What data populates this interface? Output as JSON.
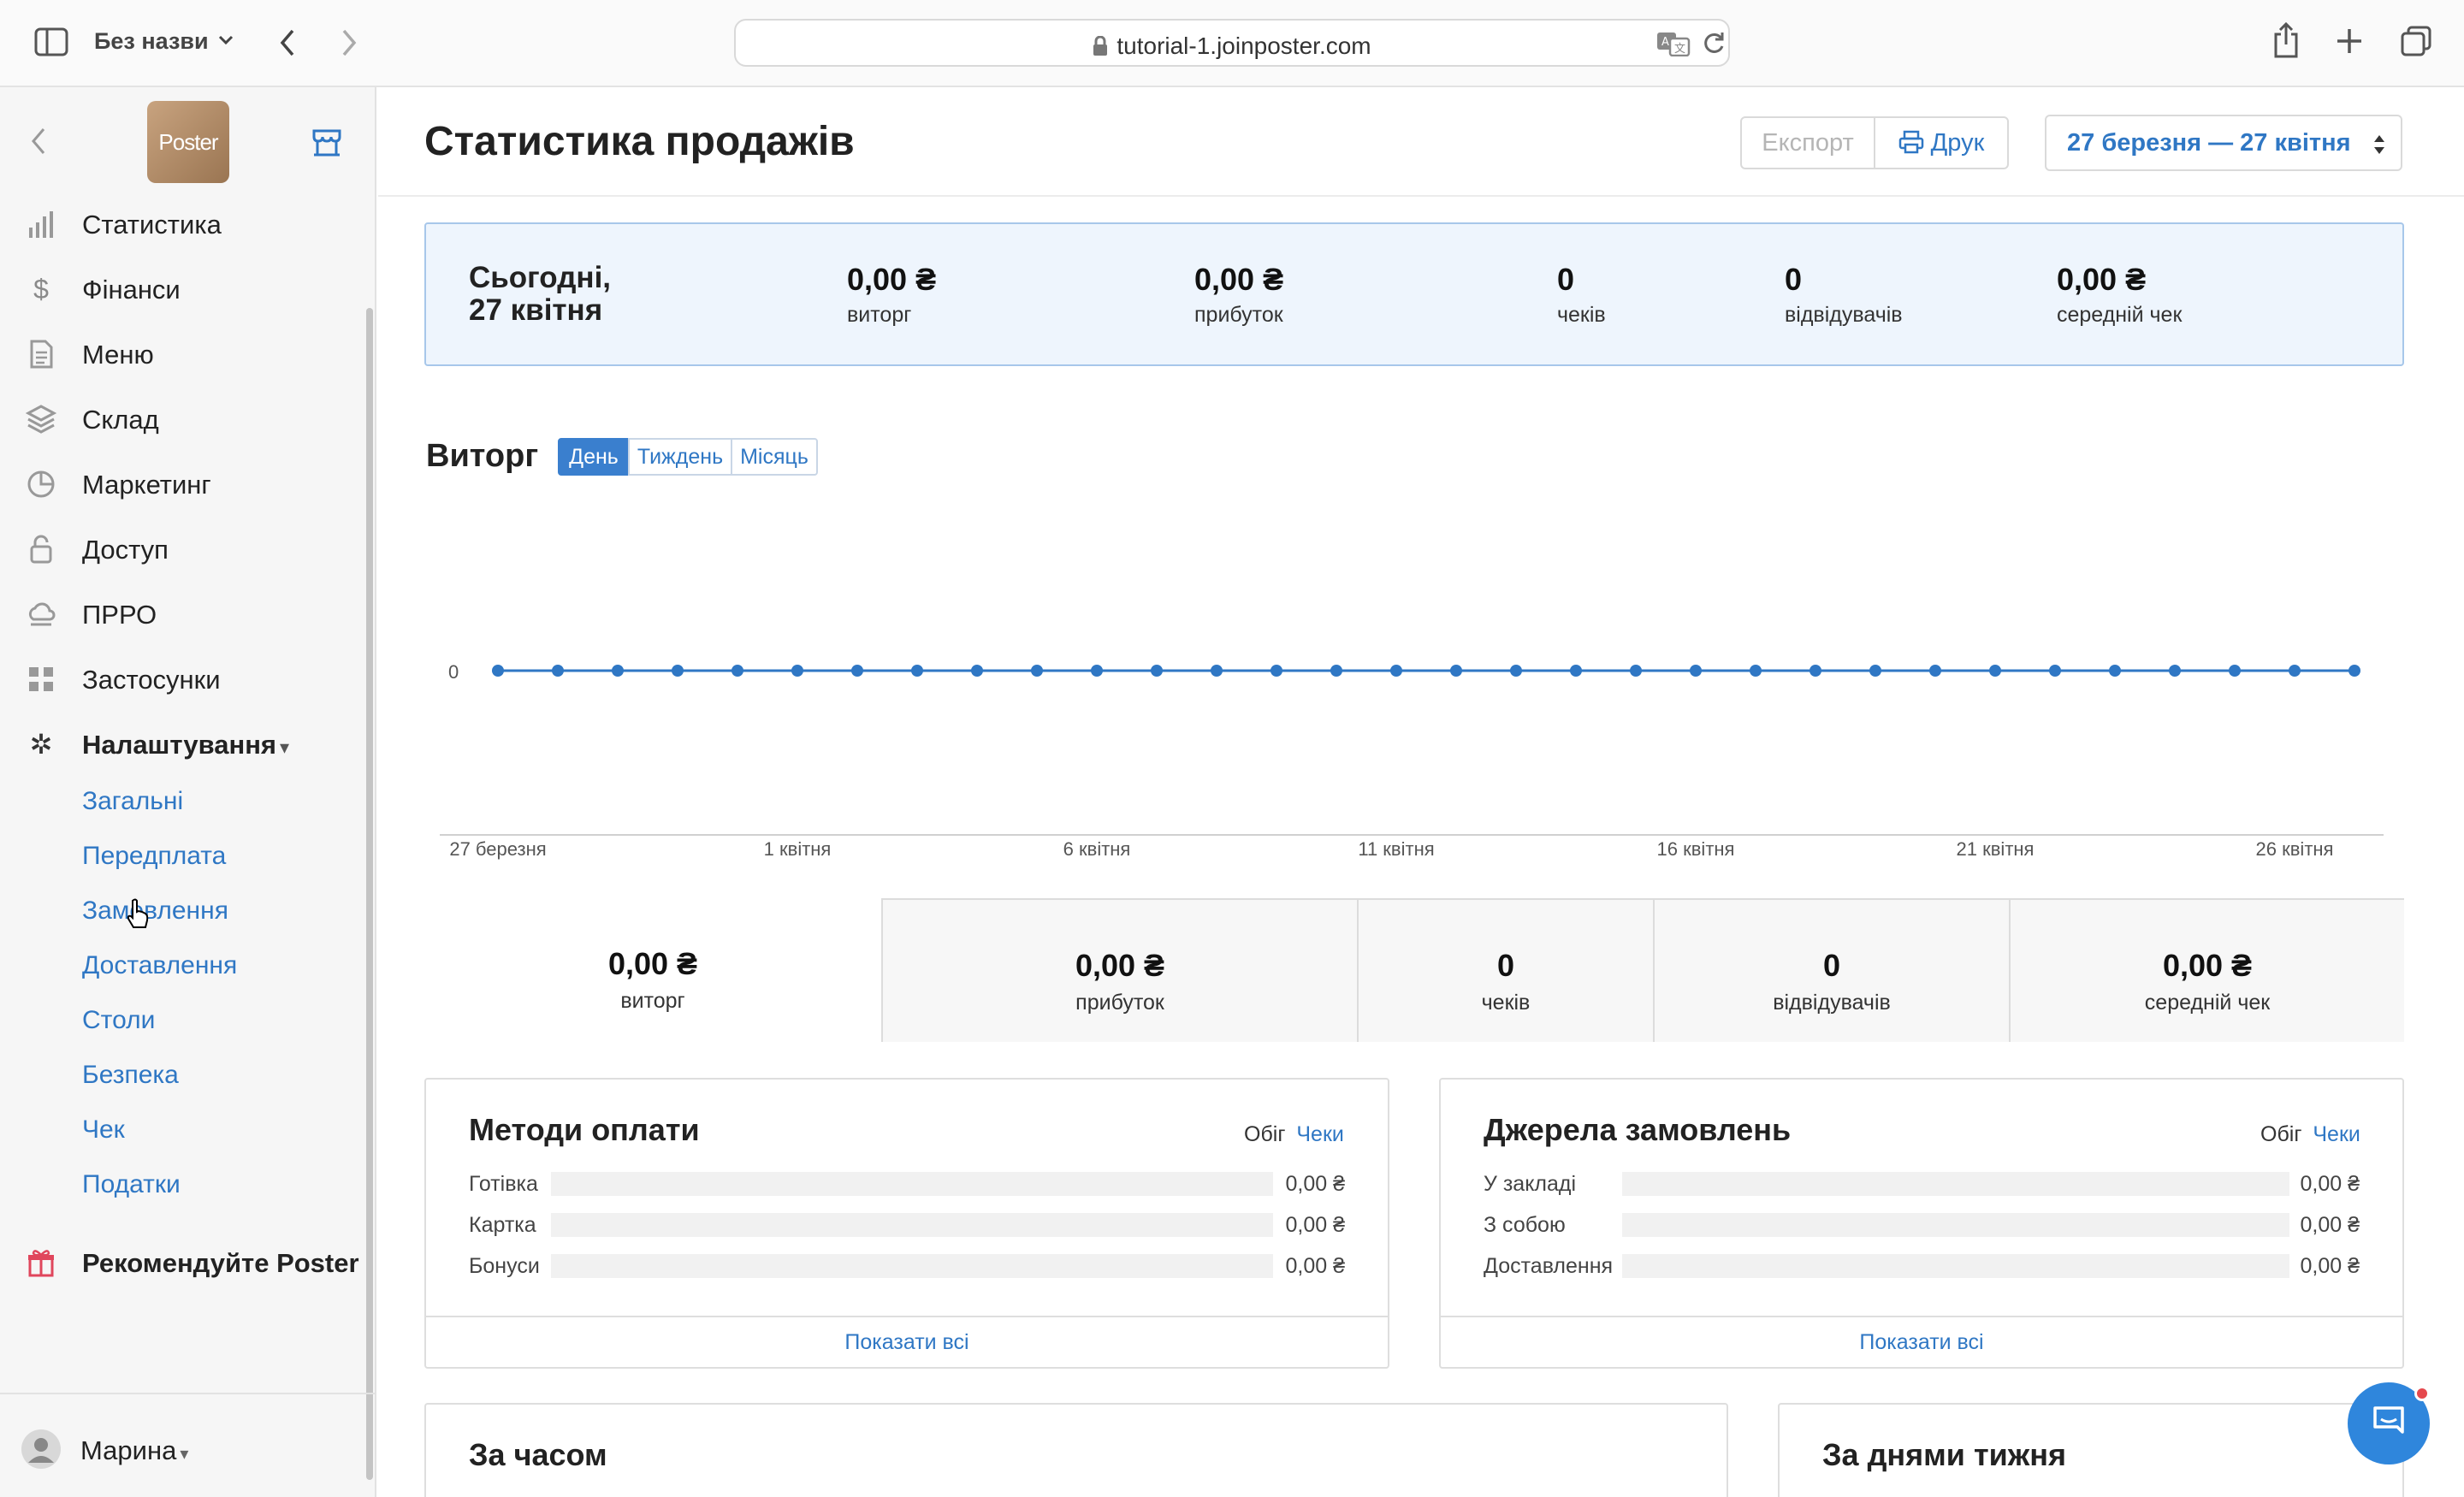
{
  "browser": {
    "tab_group_title": "Без назви",
    "url": "tutorial-1.joinposter.com"
  },
  "sidebar": {
    "logo_text": "Poster",
    "items": [
      {
        "label": "Статистика",
        "icon": "bar-chart-icon"
      },
      {
        "label": "Фінанси",
        "icon": "dollar-icon"
      },
      {
        "label": "Меню",
        "icon": "document-icon"
      },
      {
        "label": "Склад",
        "icon": "layers-icon"
      },
      {
        "label": "Маркетинг",
        "icon": "pie-icon"
      },
      {
        "label": "Доступ",
        "icon": "lock-icon"
      },
      {
        "label": "ПРРО",
        "icon": "cloud-icon"
      },
      {
        "label": "Застосунки",
        "icon": "grid-icon"
      },
      {
        "label": "Налаштування",
        "icon": "gear-icon"
      }
    ],
    "settings_caret": "▾",
    "subitems": [
      "Загальні",
      "Передплата",
      "Замовлення",
      "Доставлення",
      "Столи",
      "Безпека",
      "Чек",
      "Податки"
    ],
    "recommend": "Рекомендуйте Poster",
    "user": "Марина",
    "user_caret": "▾"
  },
  "header": {
    "title": "Статистика продажів",
    "export": "Експорт",
    "print": "Друк",
    "date_range": "27 березня — 27 квітня"
  },
  "today": {
    "title_line1": "Сьогодні,",
    "title_line2": "27 квітня",
    "stats": [
      {
        "value": "0,00 ₴",
        "label": "виторг"
      },
      {
        "value": "0,00 ₴",
        "label": "прибуток"
      },
      {
        "value": "0",
        "label": "чеків"
      },
      {
        "value": "0",
        "label": "відвідувачів"
      },
      {
        "value": "0,00 ₴",
        "label": "середній чек"
      }
    ]
  },
  "revenue": {
    "title": "Виторг",
    "periods": [
      "День",
      "Тиждень",
      "Місяць"
    ],
    "active_period": "День"
  },
  "chart_data": {
    "type": "line",
    "title": "",
    "xlabel": "",
    "ylabel": "",
    "x_tick_labels": [
      "27 березня",
      "1 квітня",
      "6 квітня",
      "11 квітня",
      "16 квітня",
      "21 квітня",
      "26 квітня"
    ],
    "y_tick_labels": [
      "0"
    ],
    "x_count_days": 32,
    "series": [
      {
        "values": [
          0,
          0,
          0,
          0,
          0,
          0,
          0,
          0,
          0,
          0,
          0,
          0,
          0,
          0,
          0,
          0,
          0,
          0,
          0,
          0,
          0,
          0,
          0,
          0,
          0,
          0,
          0,
          0,
          0,
          0,
          0,
          0
        ]
      }
    ],
    "color": "#2f77c4",
    "grid": false
  },
  "summary": [
    {
      "value": "0,00 ₴",
      "label": "виторг"
    },
    {
      "value": "0,00 ₴",
      "label": "прибуток"
    },
    {
      "value": "0",
      "label": "чеків"
    },
    {
      "value": "0",
      "label": "відвідувачів"
    },
    {
      "value": "0,00 ₴",
      "label": "середній чек"
    }
  ],
  "payment_methods": {
    "title": "Методи оплати",
    "toggle_turnover": "Обіг",
    "toggle_checks": "Чеки",
    "rows": [
      {
        "label": "Готівка",
        "value": "0,00 ₴"
      },
      {
        "label": "Картка",
        "value": "0,00 ₴"
      },
      {
        "label": "Бонуси",
        "value": "0,00 ₴"
      }
    ],
    "show_all": "Показати всі"
  },
  "order_sources": {
    "title": "Джерела замовлень",
    "toggle_turnover": "Обіг",
    "toggle_checks": "Чеки",
    "rows": [
      {
        "label": "У закладі",
        "value": "0,00 ₴"
      },
      {
        "label": "З собою",
        "value": "0,00 ₴"
      },
      {
        "label": "Доставлення",
        "value": "0,00 ₴"
      }
    ],
    "show_all": "Показати всі"
  },
  "by_time": {
    "title": "За часом"
  },
  "by_weekday": {
    "title": "За днями тижня"
  }
}
